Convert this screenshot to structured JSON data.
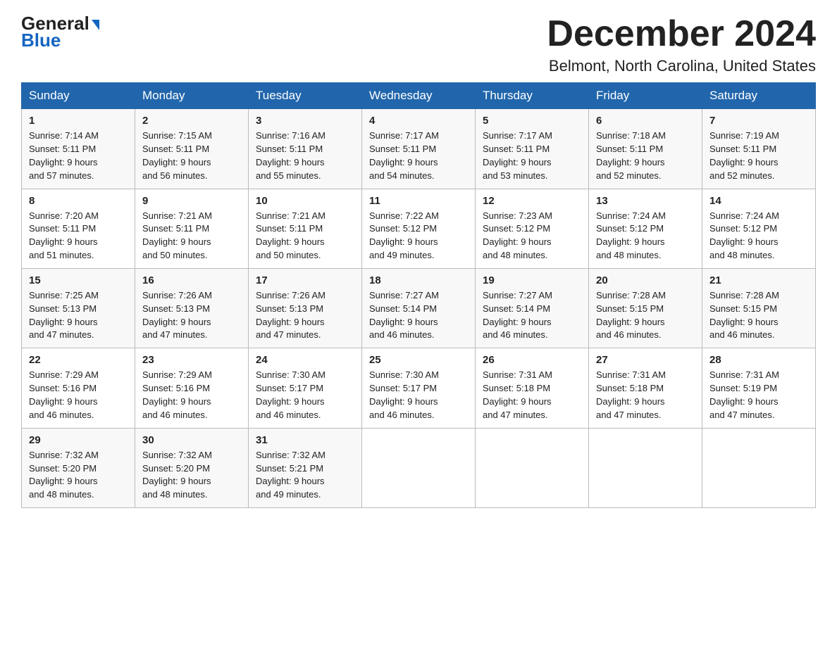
{
  "logo": {
    "line1": "General",
    "arrow": "▶",
    "line2": "Blue"
  },
  "title": "December 2024",
  "location": "Belmont, North Carolina, United States",
  "days_of_week": [
    "Sunday",
    "Monday",
    "Tuesday",
    "Wednesday",
    "Thursday",
    "Friday",
    "Saturday"
  ],
  "weeks": [
    [
      {
        "day": "1",
        "sunrise": "7:14 AM",
        "sunset": "5:11 PM",
        "daylight": "9 hours and 57 minutes."
      },
      {
        "day": "2",
        "sunrise": "7:15 AM",
        "sunset": "5:11 PM",
        "daylight": "9 hours and 56 minutes."
      },
      {
        "day": "3",
        "sunrise": "7:16 AM",
        "sunset": "5:11 PM",
        "daylight": "9 hours and 55 minutes."
      },
      {
        "day": "4",
        "sunrise": "7:17 AM",
        "sunset": "5:11 PM",
        "daylight": "9 hours and 54 minutes."
      },
      {
        "day": "5",
        "sunrise": "7:17 AM",
        "sunset": "5:11 PM",
        "daylight": "9 hours and 53 minutes."
      },
      {
        "day": "6",
        "sunrise": "7:18 AM",
        "sunset": "5:11 PM",
        "daylight": "9 hours and 52 minutes."
      },
      {
        "day": "7",
        "sunrise": "7:19 AM",
        "sunset": "5:11 PM",
        "daylight": "9 hours and 52 minutes."
      }
    ],
    [
      {
        "day": "8",
        "sunrise": "7:20 AM",
        "sunset": "5:11 PM",
        "daylight": "9 hours and 51 minutes."
      },
      {
        "day": "9",
        "sunrise": "7:21 AM",
        "sunset": "5:11 PM",
        "daylight": "9 hours and 50 minutes."
      },
      {
        "day": "10",
        "sunrise": "7:21 AM",
        "sunset": "5:11 PM",
        "daylight": "9 hours and 50 minutes."
      },
      {
        "day": "11",
        "sunrise": "7:22 AM",
        "sunset": "5:12 PM",
        "daylight": "9 hours and 49 minutes."
      },
      {
        "day": "12",
        "sunrise": "7:23 AM",
        "sunset": "5:12 PM",
        "daylight": "9 hours and 48 minutes."
      },
      {
        "day": "13",
        "sunrise": "7:24 AM",
        "sunset": "5:12 PM",
        "daylight": "9 hours and 48 minutes."
      },
      {
        "day": "14",
        "sunrise": "7:24 AM",
        "sunset": "5:12 PM",
        "daylight": "9 hours and 48 minutes."
      }
    ],
    [
      {
        "day": "15",
        "sunrise": "7:25 AM",
        "sunset": "5:13 PM",
        "daylight": "9 hours and 47 minutes."
      },
      {
        "day": "16",
        "sunrise": "7:26 AM",
        "sunset": "5:13 PM",
        "daylight": "9 hours and 47 minutes."
      },
      {
        "day": "17",
        "sunrise": "7:26 AM",
        "sunset": "5:13 PM",
        "daylight": "9 hours and 47 minutes."
      },
      {
        "day": "18",
        "sunrise": "7:27 AM",
        "sunset": "5:14 PM",
        "daylight": "9 hours and 46 minutes."
      },
      {
        "day": "19",
        "sunrise": "7:27 AM",
        "sunset": "5:14 PM",
        "daylight": "9 hours and 46 minutes."
      },
      {
        "day": "20",
        "sunrise": "7:28 AM",
        "sunset": "5:15 PM",
        "daylight": "9 hours and 46 minutes."
      },
      {
        "day": "21",
        "sunrise": "7:28 AM",
        "sunset": "5:15 PM",
        "daylight": "9 hours and 46 minutes."
      }
    ],
    [
      {
        "day": "22",
        "sunrise": "7:29 AM",
        "sunset": "5:16 PM",
        "daylight": "9 hours and 46 minutes."
      },
      {
        "day": "23",
        "sunrise": "7:29 AM",
        "sunset": "5:16 PM",
        "daylight": "9 hours and 46 minutes."
      },
      {
        "day": "24",
        "sunrise": "7:30 AM",
        "sunset": "5:17 PM",
        "daylight": "9 hours and 46 minutes."
      },
      {
        "day": "25",
        "sunrise": "7:30 AM",
        "sunset": "5:17 PM",
        "daylight": "9 hours and 46 minutes."
      },
      {
        "day": "26",
        "sunrise": "7:31 AM",
        "sunset": "5:18 PM",
        "daylight": "9 hours and 47 minutes."
      },
      {
        "day": "27",
        "sunrise": "7:31 AM",
        "sunset": "5:18 PM",
        "daylight": "9 hours and 47 minutes."
      },
      {
        "day": "28",
        "sunrise": "7:31 AM",
        "sunset": "5:19 PM",
        "daylight": "9 hours and 47 minutes."
      }
    ],
    [
      {
        "day": "29",
        "sunrise": "7:32 AM",
        "sunset": "5:20 PM",
        "daylight": "9 hours and 48 minutes."
      },
      {
        "day": "30",
        "sunrise": "7:32 AM",
        "sunset": "5:20 PM",
        "daylight": "9 hours and 48 minutes."
      },
      {
        "day": "31",
        "sunrise": "7:32 AM",
        "sunset": "5:21 PM",
        "daylight": "9 hours and 49 minutes."
      },
      null,
      null,
      null,
      null
    ]
  ]
}
